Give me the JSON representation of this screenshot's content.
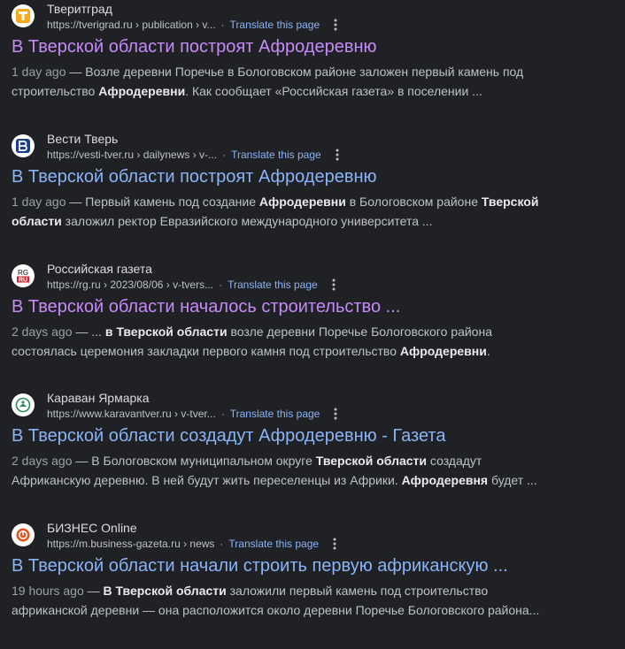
{
  "translate_label": "Translate this page",
  "results": [
    {
      "site_name": "Тверитград",
      "url": "https://tverigrad.ru › publication › v...",
      "title": "В Тверской области построят Афродеревню",
      "favicon_icon": "tverigrad-logo-icon",
      "snippet": {
        "date": "1 day ago",
        "p1": " — Возле деревни Поречье в Бологовском районе заложен первый камень под строительство ",
        "b1": "Афродеревни",
        "p2": ". Как сообщает «Российская газета» в поселении ...",
        "b2": "",
        "p3": "",
        "b3": "",
        "p4": ""
      }
    },
    {
      "site_name": "Вести Тверь",
      "url": "https://vesti-tver.ru › dailynews › v-...",
      "title": "В Тверской области построят Афродеревню",
      "favicon_icon": "vesti-logo-icon",
      "snippet": {
        "date": "1 day ago",
        "p1": " — Первый камень под создание ",
        "b1": "Афродеревни",
        "p2": " в Бологовском районе ",
        "b2": "Тверской области",
        "p3": " заложил ректор Евразийского международного университета ...",
        "b3": "",
        "p4": ""
      }
    },
    {
      "site_name": "Российская газета",
      "url": "https://rg.ru › 2023/08/06 › v-tvers...",
      "title": "В Тверской области началось строительство ...",
      "favicon_icon": "rg-logo-icon",
      "snippet": {
        "date": "2 days ago",
        "p1": " — ... ",
        "b1": "в Тверской области",
        "p2": " возле деревни Поречье Бологовского района состоялась церемония закладки первого камня под строительство ",
        "b2": "Афродеревни",
        "p3": ".",
        "b3": "",
        "p4": ""
      }
    },
    {
      "site_name": "Караван Ярмарка",
      "url": "https://www.karavantver.ru › v-tver...",
      "title": "В Тверской области создадут Афродеревню - Газета",
      "favicon_icon": "karavan-logo-icon",
      "snippet": {
        "date": "2 days ago",
        "p1": " — В Бологовском муниципальном округе ",
        "b1": "Тверской области",
        "p2": " создадут Африканскую деревню. В ней будут жить переселенцы из Африки. ",
        "b2": "Афродеревня",
        "p3": " будет ...",
        "b3": "",
        "p4": ""
      }
    },
    {
      "site_name": "БИЗНЕС Online",
      "url": "https://m.business-gazeta.ru › news",
      "title": "В Тверской области начали строить первую африканскую ...",
      "favicon_icon": "business-online-logo-icon",
      "snippet": {
        "date": "19 hours ago",
        "p1": " — ",
        "b1": "В Тверской области",
        "p2": " заложили первый камень под строительство африканской деревни — она расположится около деревни Поречье Бологовского района...",
        "b2": "",
        "p3": "",
        "b3": "",
        "p4": ""
      }
    }
  ]
}
